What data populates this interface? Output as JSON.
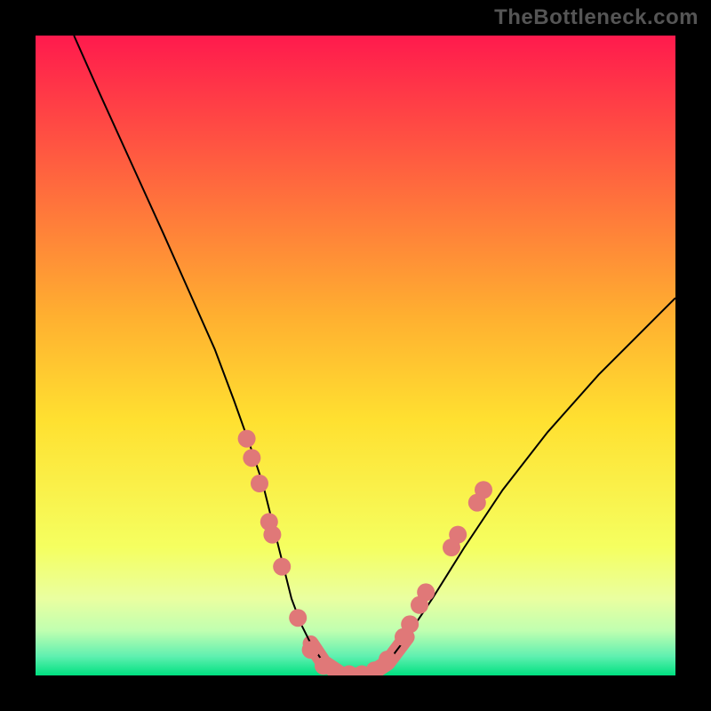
{
  "watermark": "TheBottleneck.com",
  "chart_data": {
    "type": "line",
    "title": "",
    "xlabel": "",
    "ylabel": "",
    "xlim": [
      0,
      100
    ],
    "ylim": [
      0,
      100
    ],
    "grid": false,
    "legend": false,
    "background_gradient": {
      "stops": [
        {
          "pos": 0.0,
          "color": "#ff1a4d"
        },
        {
          "pos": 0.44,
          "color": "#ffb030"
        },
        {
          "pos": 0.6,
          "color": "#ffe030"
        },
        {
          "pos": 0.8,
          "color": "#f5ff60"
        },
        {
          "pos": 0.88,
          "color": "#eaffa0"
        },
        {
          "pos": 0.93,
          "color": "#c0ffb0"
        },
        {
          "pos": 0.97,
          "color": "#60f0b0"
        },
        {
          "pos": 1.0,
          "color": "#00e080"
        }
      ]
    },
    "series": [
      {
        "name": "bottleneck-curve",
        "color": "#000000",
        "thick_peach_band_y_range": [
          0,
          6
        ],
        "x": [
          6,
          10,
          15,
          20,
          24,
          28,
          31,
          33.5,
          35.5,
          37,
          38.5,
          40,
          41.5,
          43,
          45,
          48,
          52,
          55,
          58,
          62,
          67,
          73,
          80,
          88,
          98,
          100
        ],
        "y": [
          100,
          91,
          80,
          69,
          60,
          51,
          43,
          36,
          30,
          24,
          18,
          12,
          8,
          5,
          2,
          0,
          0,
          2,
          6,
          12,
          20,
          29,
          38,
          47,
          57,
          59
        ],
        "flat_bottom_x_range": [
          45,
          54
        ]
      }
    ],
    "marker_points": {
      "color": "#e07878",
      "radius": 10,
      "points": [
        {
          "x": 33.0,
          "y": 37
        },
        {
          "x": 33.8,
          "y": 34
        },
        {
          "x": 35.0,
          "y": 30
        },
        {
          "x": 36.5,
          "y": 24
        },
        {
          "x": 37.0,
          "y": 22
        },
        {
          "x": 38.5,
          "y": 17
        },
        {
          "x": 41.0,
          "y": 9
        },
        {
          "x": 43.0,
          "y": 4
        },
        {
          "x": 45.0,
          "y": 1.5
        },
        {
          "x": 47.0,
          "y": 0.5
        },
        {
          "x": 49.0,
          "y": 0.2
        },
        {
          "x": 51.0,
          "y": 0.2
        },
        {
          "x": 53.0,
          "y": 0.8
        },
        {
          "x": 55.0,
          "y": 2.5
        },
        {
          "x": 57.5,
          "y": 6
        },
        {
          "x": 58.5,
          "y": 8
        },
        {
          "x": 60.0,
          "y": 11
        },
        {
          "x": 61.0,
          "y": 13
        },
        {
          "x": 65.0,
          "y": 20
        },
        {
          "x": 66.0,
          "y": 22
        },
        {
          "x": 69.0,
          "y": 27
        },
        {
          "x": 70.0,
          "y": 29
        }
      ]
    }
  }
}
